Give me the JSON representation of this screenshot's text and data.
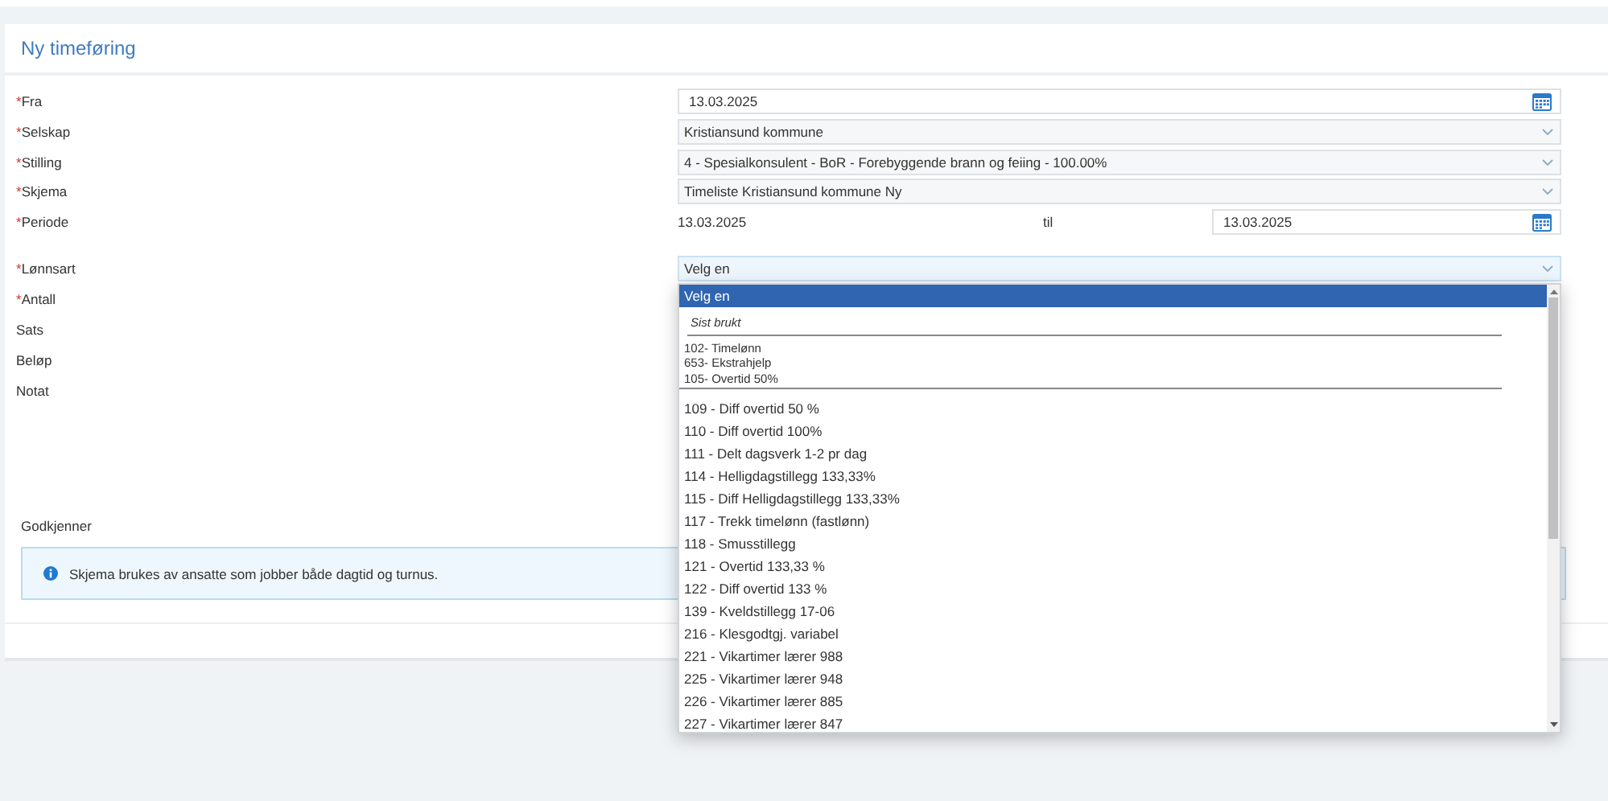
{
  "panel": {
    "title": "Ny timeføring"
  },
  "fields": [
    {
      "kind": "date",
      "required_mark": "*",
      "label": "Fra",
      "value": "13.03.2025"
    },
    {
      "kind": "select",
      "required_mark": "*",
      "label": "Selskap",
      "value": "Kristiansund kommune"
    },
    {
      "kind": "select",
      "required_mark": "*",
      "label": "Stilling",
      "value": "4 - Spesialkonsulent - BoR - Forebyggende brann og feiing - 100.00%"
    },
    {
      "kind": "select",
      "required_mark": "*",
      "label": "Skjema",
      "value": "Timeliste Kristiansund kommune Ny"
    },
    {
      "kind": "period",
      "required_mark": "*",
      "label": "Periode",
      "value": "13.03.2025",
      "separator": "til",
      "end_value": "13.03.2025"
    },
    {
      "kind": "open-select",
      "required_mark": "*",
      "label": "Lønnsart",
      "value": "Velg en"
    },
    {
      "kind": "label",
      "required_mark": "*",
      "label": "Antall"
    },
    {
      "kind": "label",
      "label": "Sats"
    },
    {
      "kind": "label",
      "label": "Beløp"
    },
    {
      "kind": "label",
      "label": "Notat"
    }
  ],
  "approver": {
    "label": "Godkjenner"
  },
  "info": {
    "text": "Skjema brukes av ansatte som jobber både dagtid og turnus."
  },
  "dropdown": {
    "options": [
      {
        "label": "Velg en",
        "selected": true
      }
    ],
    "recent_heading": "Sist brukt",
    "recent": [
      "102- Timelønn",
      "653- Ekstrahjelp",
      "105- Overtid 50%"
    ],
    "items": [
      {
        "label": "109 - Diff overtid 50 %",
        "selected": false
      },
      {
        "label": "110 - Diff overtid 100%",
        "selected": false
      },
      {
        "label": "111 - Delt dagsverk 1-2 pr dag",
        "selected": false
      },
      {
        "label": "114 - Helligdagstillegg 133,33%",
        "selected": false
      },
      {
        "label": "115 - Diff Helligdagstillegg 133,33%",
        "selected": false
      },
      {
        "label": "117 - Trekk timelønn (fastlønn)",
        "selected": false
      },
      {
        "label": "118 - Smusstillegg",
        "selected": false
      },
      {
        "label": "121 - Overtid 133,33 %",
        "selected": false
      },
      {
        "label": "122 - Diff overtid 133 %",
        "selected": false
      },
      {
        "label": "139 - Kveldstillegg 17-06",
        "selected": false
      },
      {
        "label": "216 - Klesgodtgj. variabel",
        "selected": false
      },
      {
        "label": "221 - Vikartimer lærer 988",
        "selected": false
      },
      {
        "label": "225 - Vikartimer lærer 948",
        "selected": false
      },
      {
        "label": "226 - Vikartimer lærer 885",
        "selected": false
      },
      {
        "label": "227 - Vikartimer lærer 847",
        "selected": false
      }
    ]
  }
}
